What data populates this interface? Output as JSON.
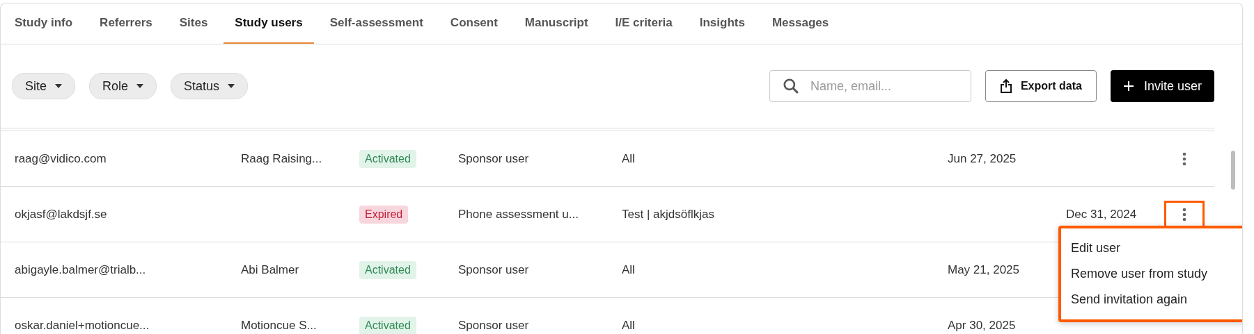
{
  "tabs": [
    {
      "label": "Study info",
      "selected": false
    },
    {
      "label": "Referrers",
      "selected": false
    },
    {
      "label": "Sites",
      "selected": false
    },
    {
      "label": "Study users",
      "selected": true
    },
    {
      "label": "Self-assessment",
      "selected": false
    },
    {
      "label": "Consent",
      "selected": false
    },
    {
      "label": "Manuscript",
      "selected": false
    },
    {
      "label": "I/E criteria",
      "selected": false
    },
    {
      "label": "Insights",
      "selected": false
    },
    {
      "label": "Messages",
      "selected": false
    }
  ],
  "filters": [
    {
      "label": "Site"
    },
    {
      "label": "Role"
    },
    {
      "label": "Status"
    }
  ],
  "search": {
    "placeholder": "Name, email..."
  },
  "export_button": {
    "label": "Export data"
  },
  "invite_button": {
    "label": "Invite user"
  },
  "rows": [
    {
      "email": "raag@vidico.com",
      "name": "Raag Raising...",
      "status": {
        "label": "Activated",
        "kind": "activated"
      },
      "role": "Sponsor user",
      "sites": "All",
      "column_6": "Jun 27, 2025",
      "menu_open": false
    },
    {
      "email": "okjasf@lakdsjf.se",
      "status": {
        "label": "Expired",
        "kind": "expired"
      },
      "role": "Phone assessment u...",
      "sites": "Test | akjdsöflkjas",
      "column_7": "Dec 31, 2024",
      "menu_open": true
    },
    {
      "email": "abigayle.balmer@trialb...",
      "name": "Abi Balmer",
      "status": {
        "label": "Activated",
        "kind": "activated"
      },
      "role": "Sponsor user",
      "sites": "All",
      "column_6": "May 21, 2025",
      "menu_open": false
    },
    {
      "email": "oskar.daniel+motioncue...",
      "name": "Motioncue S...",
      "status": {
        "label": "Activated",
        "kind": "activated"
      },
      "role": "Sponsor user",
      "sites": "All",
      "column_6": "Apr 30, 2025",
      "menu_open": false
    }
  ],
  "row_menu": {
    "items": [
      "Edit user",
      "Remove user from study",
      "Send invitation again"
    ]
  }
}
